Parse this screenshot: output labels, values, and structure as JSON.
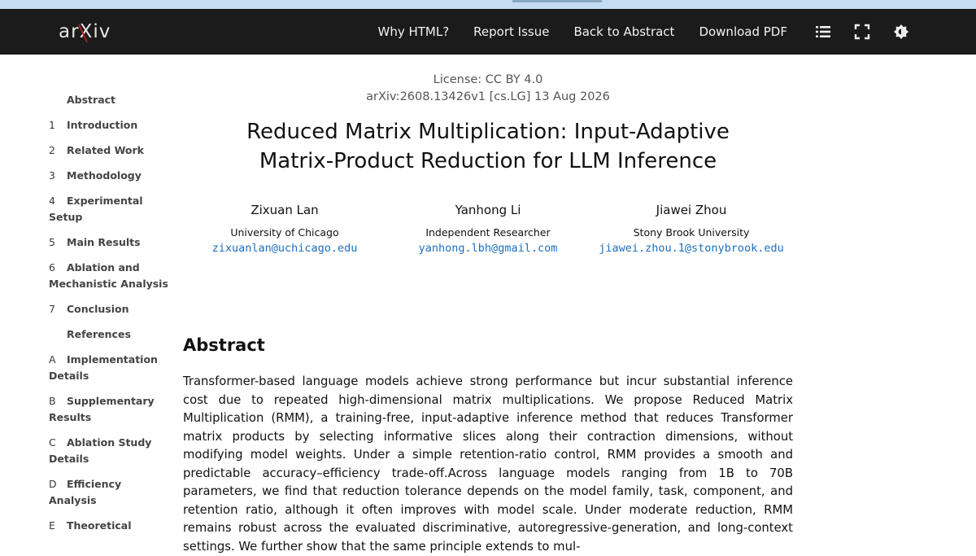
{
  "navbar": {
    "logo_text": "arXiv",
    "links": [
      "Why HTML?",
      "Report Issue",
      "Back to Abstract",
      "Download PDF"
    ],
    "icons": [
      "list-icon",
      "fullscreen-icon",
      "theme-toggle-icon"
    ]
  },
  "toc": [
    {
      "num": "",
      "label": "Abstract"
    },
    {
      "num": "1",
      "label": "Introduction"
    },
    {
      "num": "2",
      "label": "Related Work"
    },
    {
      "num": "3",
      "label": "Methodology"
    },
    {
      "num": "4",
      "label": "Experimental Setup"
    },
    {
      "num": "5",
      "label": "Main Results"
    },
    {
      "num": "6",
      "label": "Ablation and Mechanistic Analysis"
    },
    {
      "num": "7",
      "label": "Conclusion"
    },
    {
      "num": "",
      "label": "References"
    },
    {
      "num": "A",
      "label": "Implementation Details"
    },
    {
      "num": "B",
      "label": "Supplementary Results"
    },
    {
      "num": "C",
      "label": "Ablation Study Details"
    },
    {
      "num": "D",
      "label": "Efficiency Analysis"
    },
    {
      "num": "E",
      "label": "Theoretical"
    }
  ],
  "paper": {
    "license": "License: CC BY 4.0",
    "arxiv_id": "arXiv:2608.13426v1 [cs.LG] 13 Aug 2026",
    "title_line1": "Reduced Matrix Multiplication: Input-Adaptive",
    "title_line2": "Matrix-Product Reduction for LLM Inference",
    "authors": [
      {
        "name": "Zixuan Lan",
        "affiliation": "University of Chicago",
        "email": "zixuanlan@uchicago.edu"
      },
      {
        "name": "Yanhong Li",
        "affiliation": "Independent Researcher",
        "email": "yanhong.lbh@gmail.com"
      },
      {
        "name": "Jiawei Zhou",
        "affiliation": "Stony Brook University",
        "email": "jiawei.zhou.1@stonybrook.edu"
      }
    ],
    "abstract_heading": "Abstract",
    "abstract_text": "Transformer-based language models achieve strong performance but incur substantial inference cost due to repeat­ed high-dimensional matrix multiplications. We propose Reduced Matrix Multiplication (RMM), a training-free, in­put-adaptive inference method that reduces Transformer matrix products by selecting informative slices along their contraction dimensions, without modifying model weights. Under a simple retention-ratio control, RMM provides a smooth and predictable accuracy–efficiency trade-off.Across language models ranging from 1B to 70B parameters, we find that reduction tolerance depends on the model family, task, component, and retention ratio, although it of­ten improves with model scale. Under moderate reduction, RMM remains robust across the evaluated discrimina­tive, autoregressive-generation, and long-context settings. We further show that the same principle extends to mul-"
  }
}
